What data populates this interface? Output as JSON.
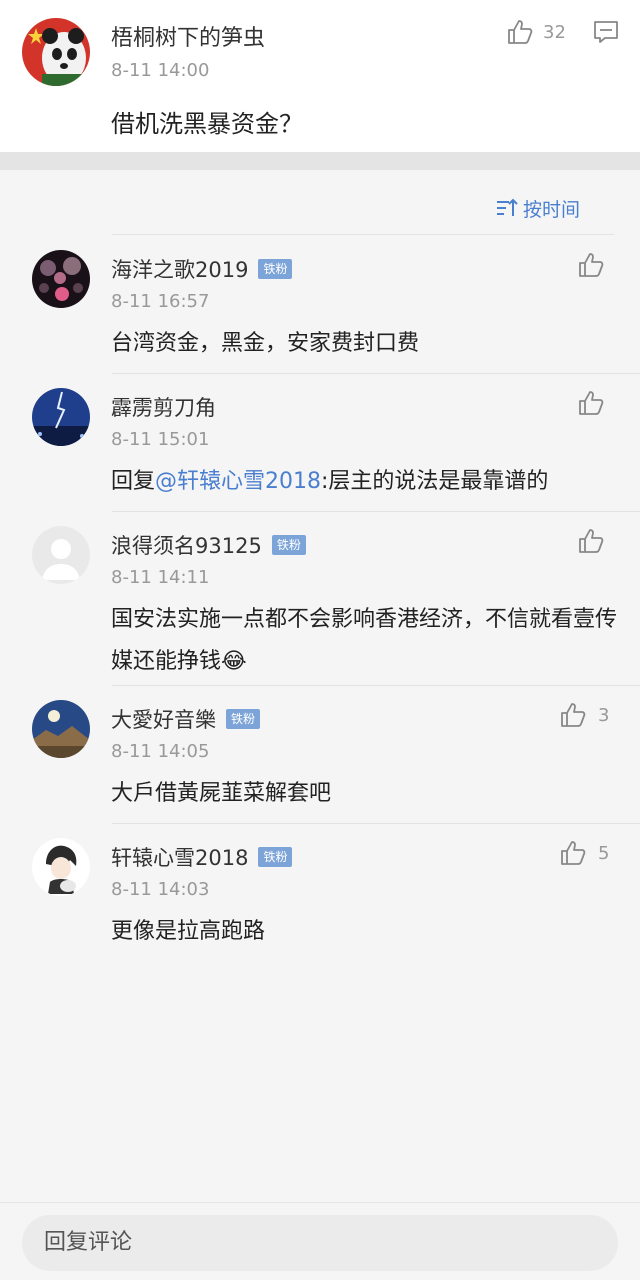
{
  "main_comment": {
    "author": "梧桐树下的笋虫",
    "time": "8-11 14:00",
    "text": "借机洗黑暴资金？",
    "like_count": "32"
  },
  "sort": {
    "label": "按时间"
  },
  "replies": [
    {
      "author": "海洋之歌2019",
      "badge": "铁粉",
      "time": "8-11 16:57",
      "text": "台湾资金，黑金，安家费封口费",
      "like_count": ""
    },
    {
      "author": "霹雳剪刀角",
      "badge": "",
      "time": "8-11 15:01",
      "reply_prefix": "回复",
      "mention": "@轩辕心雪2018",
      "text_after": ":层主的说法是最靠谱的",
      "like_count": ""
    },
    {
      "author": "浪得须名93125",
      "badge": "铁粉",
      "time": "8-11 14:11",
      "text": "国安法实施一点都不会影响香港经济，不信就看壹传媒还能挣钱",
      "emoji": "😂",
      "like_count": ""
    },
    {
      "author": "大愛好音樂",
      "badge": "铁粉",
      "time": "8-11 14:05",
      "text": "大戶借黃屍韮菜解套吧",
      "like_count": "3"
    },
    {
      "author": "轩辕心雪2018",
      "badge": "铁粉",
      "time": "8-11 14:03",
      "text": "更像是拉高跑路",
      "like_count": "5"
    }
  ],
  "bottom": {
    "input_placeholder": "回复评论"
  },
  "colors": {
    "accent": "#4a7fd0",
    "badge": "#7da4d8",
    "muted": "#999999"
  }
}
